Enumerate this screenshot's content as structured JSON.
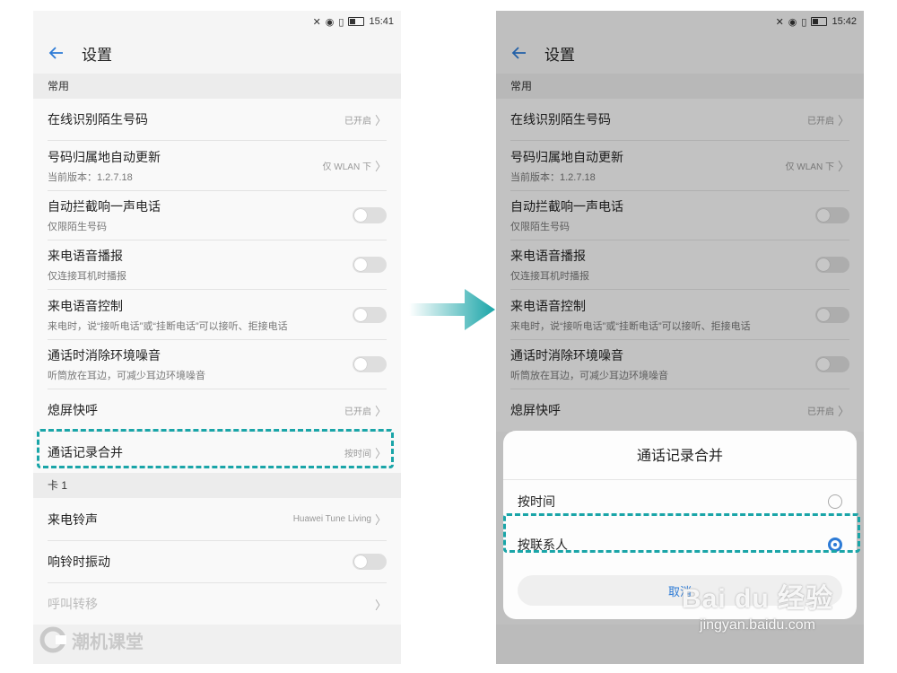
{
  "left_screen": {
    "status_time": "15:41",
    "app_title": "设置",
    "section_common": "常用",
    "items": [
      {
        "title": "在线识别陌生号码",
        "value": "已开启"
      },
      {
        "title": "号码归属地自动更新",
        "subtitle": "当前版本：1.2.7.18",
        "value": "仅 WLAN 下"
      },
      {
        "title": "自动拦截响一声电话",
        "subtitle": "仅限陌生号码"
      },
      {
        "title": "来电语音播报",
        "subtitle": "仅连接耳机时播报"
      },
      {
        "title": "来电语音控制",
        "subtitle": "来电时，说“接听电话”或“挂断电话”可以接听、拒接电话"
      },
      {
        "title": "通话时消除环境噪音",
        "subtitle": "听筒放在耳边，可减少耳边环境噪音"
      },
      {
        "title": "熄屏快呼",
        "value": "已开启"
      },
      {
        "title": "通话记录合并",
        "value": "按时间"
      }
    ],
    "section_card": "卡 1",
    "card_items": [
      {
        "title": "来电铃声",
        "value": "Huawei Tune Living"
      },
      {
        "title": "响铃时振动"
      },
      {
        "title": "呼叫转移"
      }
    ]
  },
  "right_screen": {
    "status_time": "15:42",
    "app_title": "设置",
    "section_common": "常用",
    "items": [
      {
        "title": "在线识别陌生号码",
        "value": "已开启"
      },
      {
        "title": "号码归属地自动更新",
        "subtitle": "当前版本：1.2.7.18",
        "value": "仅 WLAN 下"
      },
      {
        "title": "自动拦截响一声电话",
        "subtitle": "仅限陌生号码"
      },
      {
        "title": "来电语音播报",
        "subtitle": "仅连接耳机时播报"
      },
      {
        "title": "来电语音控制",
        "subtitle": "来电时，说“接听电话”或“挂断电话”可以接听、拒接电话"
      },
      {
        "title": "通话时消除环境噪音",
        "subtitle": "听筒放在耳边，可减少耳边环境噪音"
      },
      {
        "title": "熄屏快呼",
        "value": "已开启"
      }
    ],
    "dialog": {
      "title": "通话记录合并",
      "options": [
        {
          "label": "按时间",
          "selected": false
        },
        {
          "label": "按联系人",
          "selected": true
        }
      ],
      "cancel": "取消"
    }
  },
  "watermarks": {
    "left": "潮机课堂",
    "baidu": "Bai du 经验",
    "baidu_url": "jingyan.baidu.com"
  },
  "colors": {
    "highlight": "#1aa5a8",
    "accent": "#2d7bd6"
  },
  "icons": {
    "back": "arrow-left-icon",
    "chevron": "chevron-right-icon",
    "flow_arrow": "arrow-right-icon"
  }
}
